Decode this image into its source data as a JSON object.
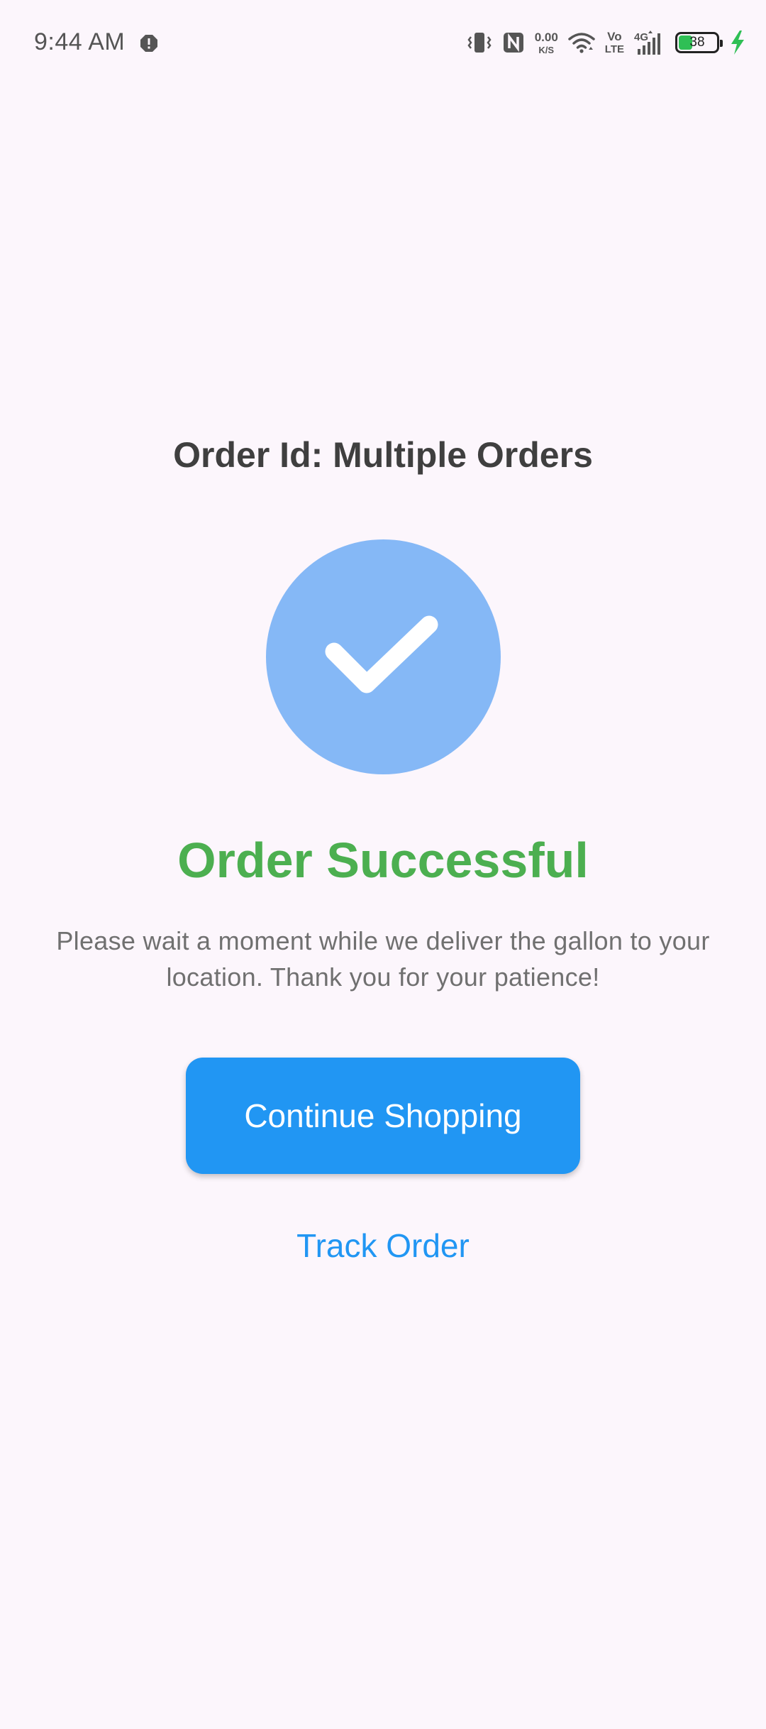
{
  "status_bar": {
    "time": "9:44 AM",
    "net_speed_value": "0.00",
    "net_speed_unit": "K/S",
    "volte_top": "Vo",
    "volte_bottom": "LTE",
    "network_type": "4G",
    "battery_level": "38",
    "icons": [
      "alert-icon",
      "vibrate-icon",
      "nfc-icon",
      "wifi-icon",
      "signal-icon",
      "battery-icon",
      "charging-icon"
    ]
  },
  "order": {
    "id_label": "Order Id: Multiple Orders",
    "success_title": "Order Successful",
    "message": "Please wait a moment while we deliver the gallon to your location. Thank you for your patience!"
  },
  "actions": {
    "continue_label": "Continue Shopping",
    "track_label": "Track Order"
  },
  "colors": {
    "background": "#fcf6fc",
    "success_green": "#4caf50",
    "primary_blue": "#2196f3",
    "check_circle": "#85b8f6",
    "battery_green": "#2fbf55"
  }
}
